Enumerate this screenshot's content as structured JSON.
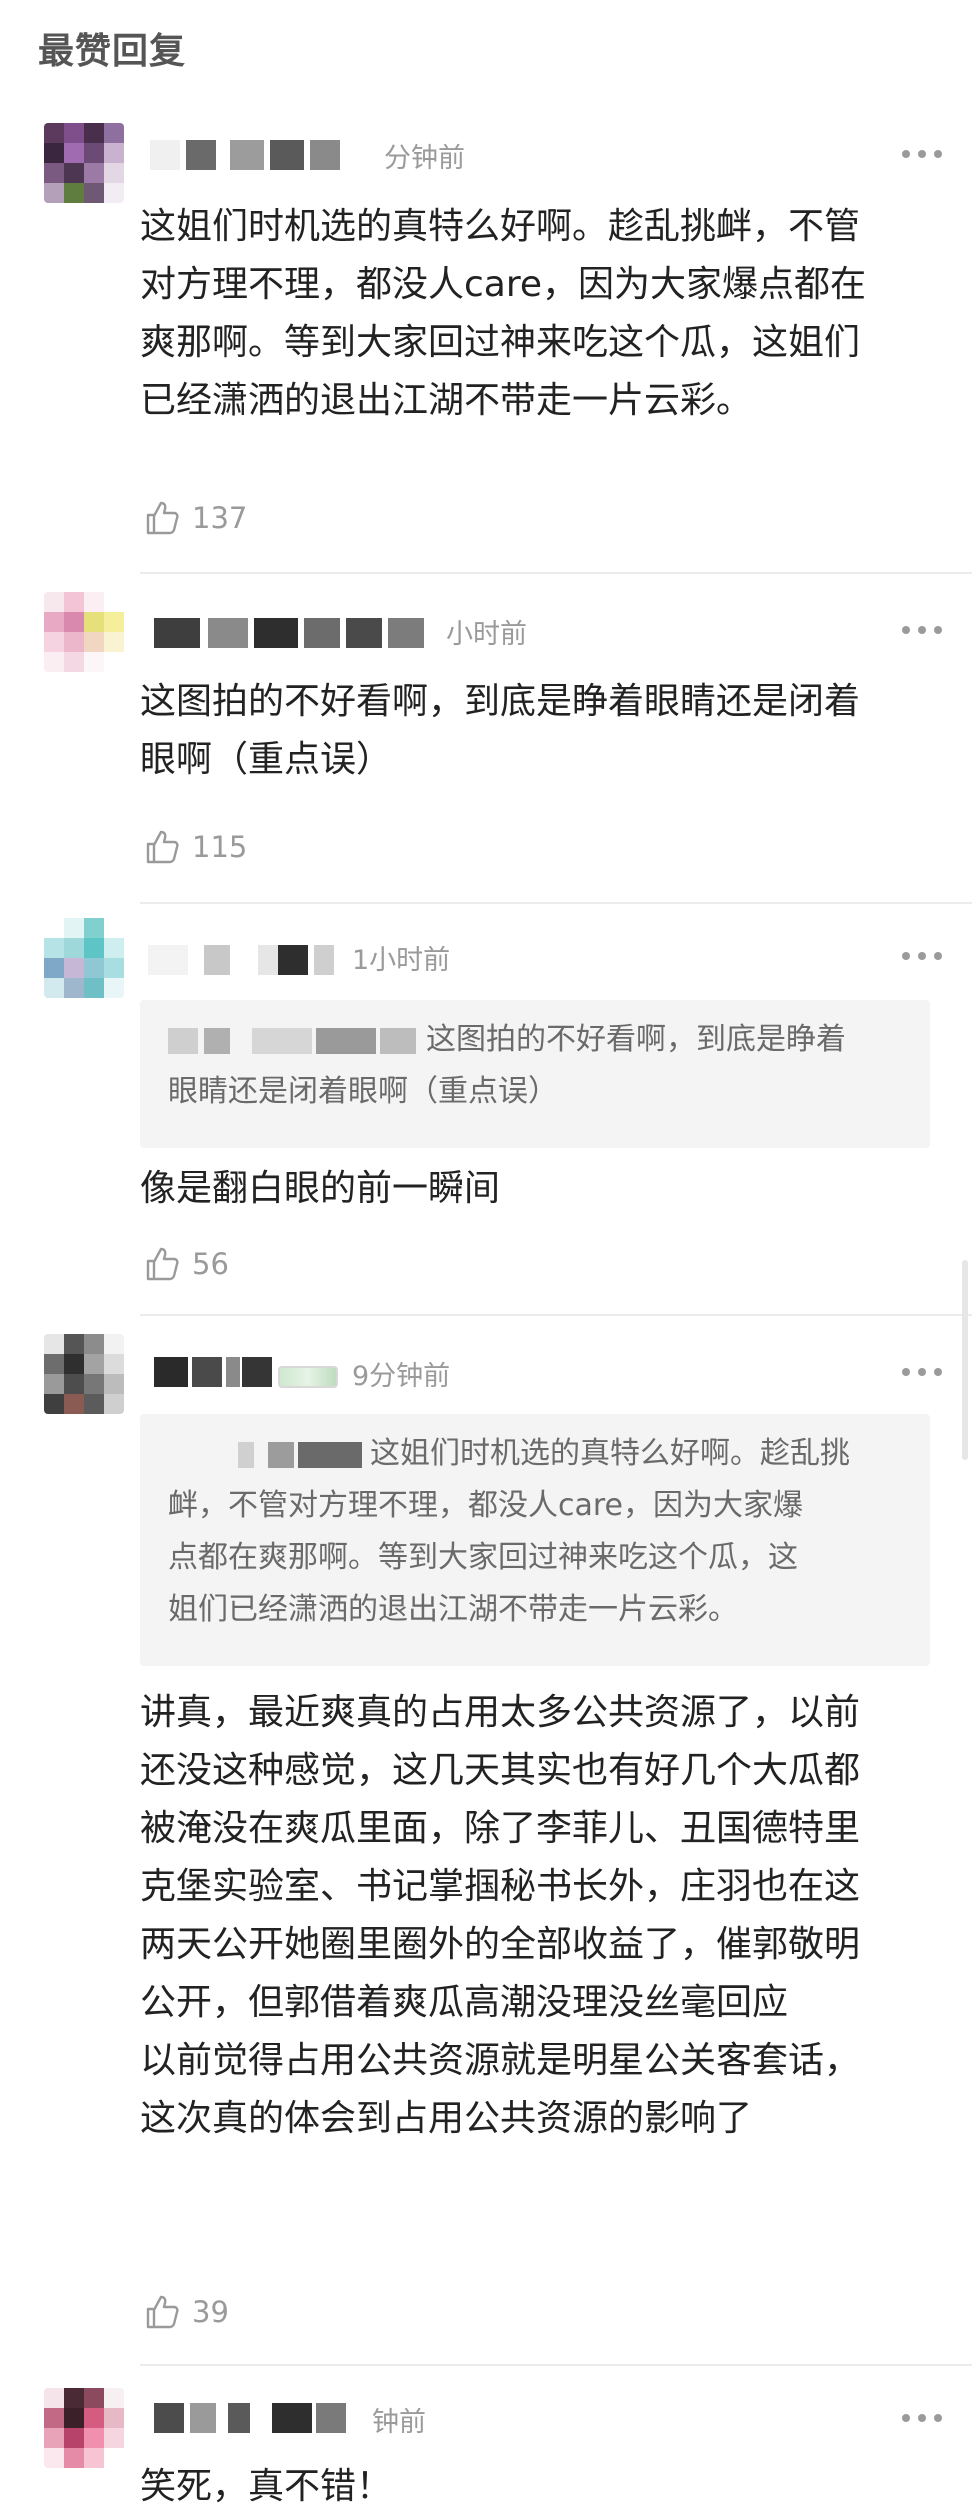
{
  "section_title": "最赞回复",
  "comments": [
    {
      "time": "分钟前",
      "text_lines": [
        "这姐们时机选的真特么好啊。趁乱挑衅，不管",
        "对方理不理，都没人care，因为大家爆点都在",
        "爽那啊。等到大家回过神来吃这个瓜，这姐们",
        "已经潇洒的退出江湖不带走一片云彩。"
      ],
      "likes": "137"
    },
    {
      "time": "小时前",
      "text_lines": [
        "这图拍的不好看啊，到底是睁着眼睛还是闭着",
        "眼啊（重点误）"
      ],
      "likes": "115"
    },
    {
      "time": "1小时前",
      "quote_lines": [
        "这图拍的不好看啊，到底是睁着",
        "眼睛还是闭着眼啊（重点误）"
      ],
      "text_lines": [
        "像是翻白眼的前一瞬间"
      ],
      "likes": "56"
    },
    {
      "time": "9分钟前",
      "quote_lines": [
        "这姐们时机选的真特么好啊。趁乱挑",
        "衅，不管对方理不理，都没人care，因为大家爆",
        "点都在爽那啊。等到大家回过神来吃这个瓜，这",
        "姐们已经潇洒的退出江湖不带走一片云彩。"
      ],
      "text_lines": [
        "讲真，最近爽真的占用太多公共资源了，以前",
        "还没这种感觉，这几天其实也有好几个大瓜都",
        "被淹没在爽瓜里面，除了李菲儿、丑国德特里",
        "克堡实验室、书记掌掴秘书长外，庄羽也在这",
        "两天公开她圈里圈外的全部收益了，催郭敬明",
        "公开，但郭借着爽瓜高潮没理没丝毫回应",
        "以前觉得占用公共资源就是明星公关客套话，",
        "这次真的体会到占用公共资源的影响了"
      ],
      "likes": "39"
    },
    {
      "time": "钟前",
      "text_lines": [
        "笑死，真不错！"
      ]
    }
  ],
  "icons": {
    "like": "thumbs-up-icon",
    "more": "more-dots-icon"
  },
  "colors": {
    "meta": "#9a9a9a",
    "text": "#222222",
    "quote_bg": "#f4f4f4",
    "divider": "#ececec"
  }
}
